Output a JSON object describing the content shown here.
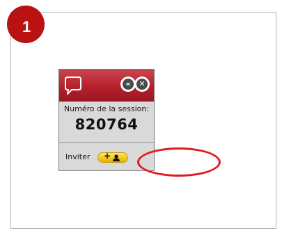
{
  "step": {
    "number": "1",
    "color": "#ba1212"
  },
  "widget": {
    "header_color": "#b5202b",
    "icons": {
      "chat": "speech-bubble-icon",
      "collapse": "double-chevron-left-icon",
      "close": "close-icon",
      "add_user": "add-user-icon"
    },
    "collapse_glyph": "«",
    "close_glyph": "✕",
    "session_label": "Numéro de la session:",
    "session_number": "820764",
    "invite_label": "Inviter",
    "add_user_glyph": "+"
  },
  "highlight": {
    "color": "#e21a1a",
    "target": "add-user-button"
  }
}
